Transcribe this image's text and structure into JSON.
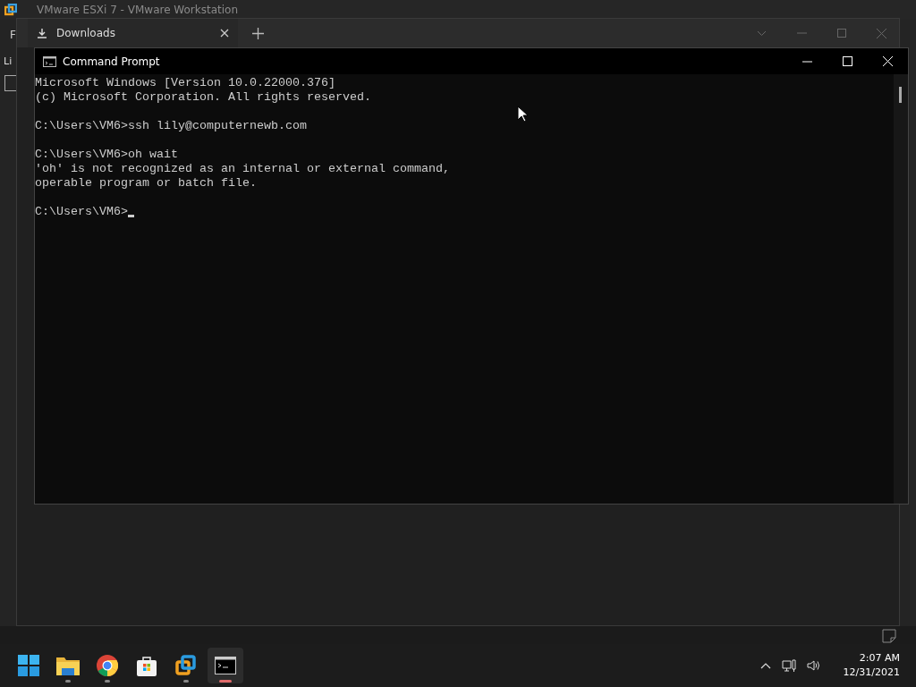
{
  "background_window": {
    "title": "VMware ESXi 7 - VMware Workstation",
    "menu_label": "F",
    "library_label": "Li",
    "library_checkbox": {
      "checked": false
    }
  },
  "explorer": {
    "tabs": [
      {
        "label": "Downloads",
        "selected": true
      }
    ]
  },
  "console": {
    "title": "Command Prompt",
    "blocks": [
      [
        "Microsoft Windows [Version 10.0.22000.376]",
        "(c) Microsoft Corporation. All rights reserved."
      ],
      [
        "C:\\Users\\VM6>ssh lily@computernewb.com"
      ],
      [
        "C:\\Users\\VM6>oh wait",
        "'oh' is not recognized as an internal or external command,",
        "operable program or batch file."
      ],
      [
        "C:\\Users\\VM6>"
      ]
    ],
    "cursor": true
  },
  "taskbar": {
    "apps": [
      {
        "kind": "start",
        "running": false,
        "selected": false
      },
      {
        "kind": "folder",
        "running": true,
        "selected": false
      },
      {
        "kind": "chrome",
        "running": true,
        "selected": false
      },
      {
        "kind": "store",
        "running": false,
        "selected": false
      },
      {
        "kind": "vmware",
        "running": true,
        "selected": false
      },
      {
        "kind": "terminal",
        "running": true,
        "selected": true
      }
    ]
  },
  "clock": {
    "time": "2:07 AM",
    "date": "12/31/2021"
  }
}
